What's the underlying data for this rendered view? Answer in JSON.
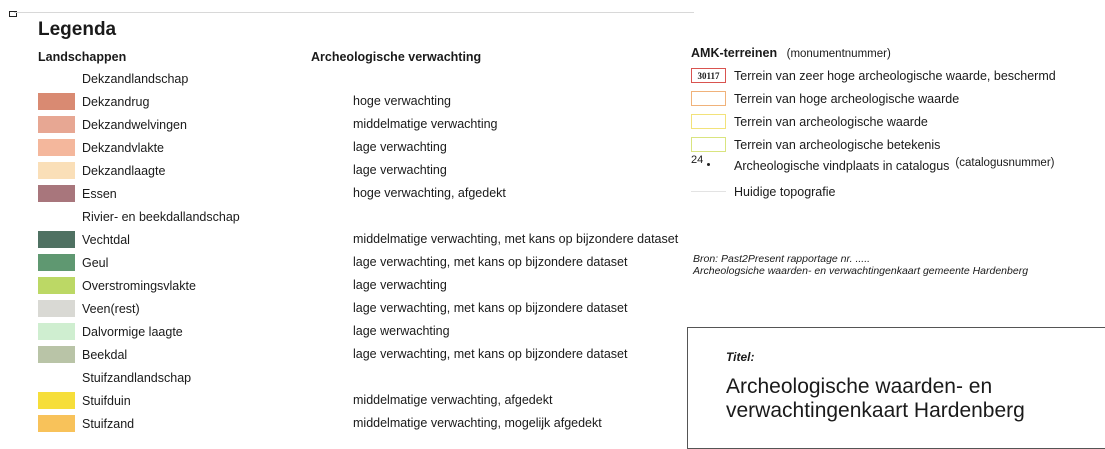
{
  "legend_title": "Legenda",
  "headers": {
    "landschappen": "Landschappen",
    "verwachting": "Archeologische verwachting"
  },
  "landscape_rows": [
    {
      "label": "Dekzandlandschap",
      "color": null,
      "desc": ""
    },
    {
      "label": "Dekzandrug",
      "color": "#d98a72",
      "desc": "hoge verwachting"
    },
    {
      "label": "Dekzandwelvingen",
      "color": "#e7a793",
      "desc": "middelmatige verwachting"
    },
    {
      "label": "Dekzandvlakte",
      "color": "#f4b79c",
      "desc": "lage verwachting"
    },
    {
      "label": "Dekzandlaagte",
      "color": "#fadfb8",
      "desc": "lage verwachting"
    },
    {
      "label": "Essen",
      "color": "#a8767c",
      "desc": "hoge verwachting, afgedekt"
    },
    {
      "label": "Rivier- en beekdallandschap",
      "color": null,
      "desc": ""
    },
    {
      "label": "Vechtdal",
      "color": "#4f7162",
      "desc": "middelmatige verwachting, met kans op bijzondere dataset"
    },
    {
      "label": "Geul",
      "color": "#5f9871",
      "desc": "lage verwachting, met kans op bijzondere dataset"
    },
    {
      "label": "Overstromingsvlakte",
      "color": "#bcd865",
      "desc": "lage verwachting"
    },
    {
      "label": "Veen(rest)",
      "color": "#d9d9d4",
      "desc": "lage verwachting, met kans op bijzondere dataset"
    },
    {
      "label": "Dalvormige laagte",
      "color": "#cfeed0",
      "desc": "lage werwachting"
    },
    {
      "label": "Beekdal",
      "color": "#b9c4a7",
      "desc": "lage verwachting, met kans op bijzondere dataset"
    },
    {
      "label": "Stuifzandlandschap",
      "color": null,
      "desc": ""
    },
    {
      "label": "Stuifduin",
      "color": "#f6de3a",
      "desc": "middelmatige verwachting, afgedekt"
    },
    {
      "label": "Stuifzand",
      "color": "#f8c25a",
      "desc": "middelmatige verwachting, mogelijk afgedekt"
    }
  ],
  "amk": {
    "title": "AMK-terreinen",
    "subtitle": "(monumentnummer)",
    "rows": [
      {
        "box_text": "30117",
        "border_color": "#d9534f",
        "label": "Terrein van zeer hoge archeologische waarde, beschermd"
      },
      {
        "box_text": "",
        "border_color": "#f0b27a",
        "label": "Terrein van hoge archeologische waarde"
      },
      {
        "box_text": "",
        "border_color": "#f2e27a",
        "label": "Terrein van archeologische waarde"
      },
      {
        "box_text": "",
        "border_color": "#d9e47f",
        "label": "Terrein van archeologische betekenis"
      }
    ],
    "vindplaats_number": "24",
    "vindplaats_label": "Archeologische vindplaats in catalogus",
    "vindplaats_note": "(catalogusnummer)",
    "topografie_label": "Huidige topografie"
  },
  "bron": {
    "line1": "Bron: Past2Present rapportage nr. .....",
    "line2": "Archeologsiche waarden- en verwachtingenkaart gemeente Hardenberg"
  },
  "titel": {
    "label": "Titel:",
    "line1": "Archeologische waarden- en",
    "line2": "verwachtingenkaart Hardenberg"
  }
}
